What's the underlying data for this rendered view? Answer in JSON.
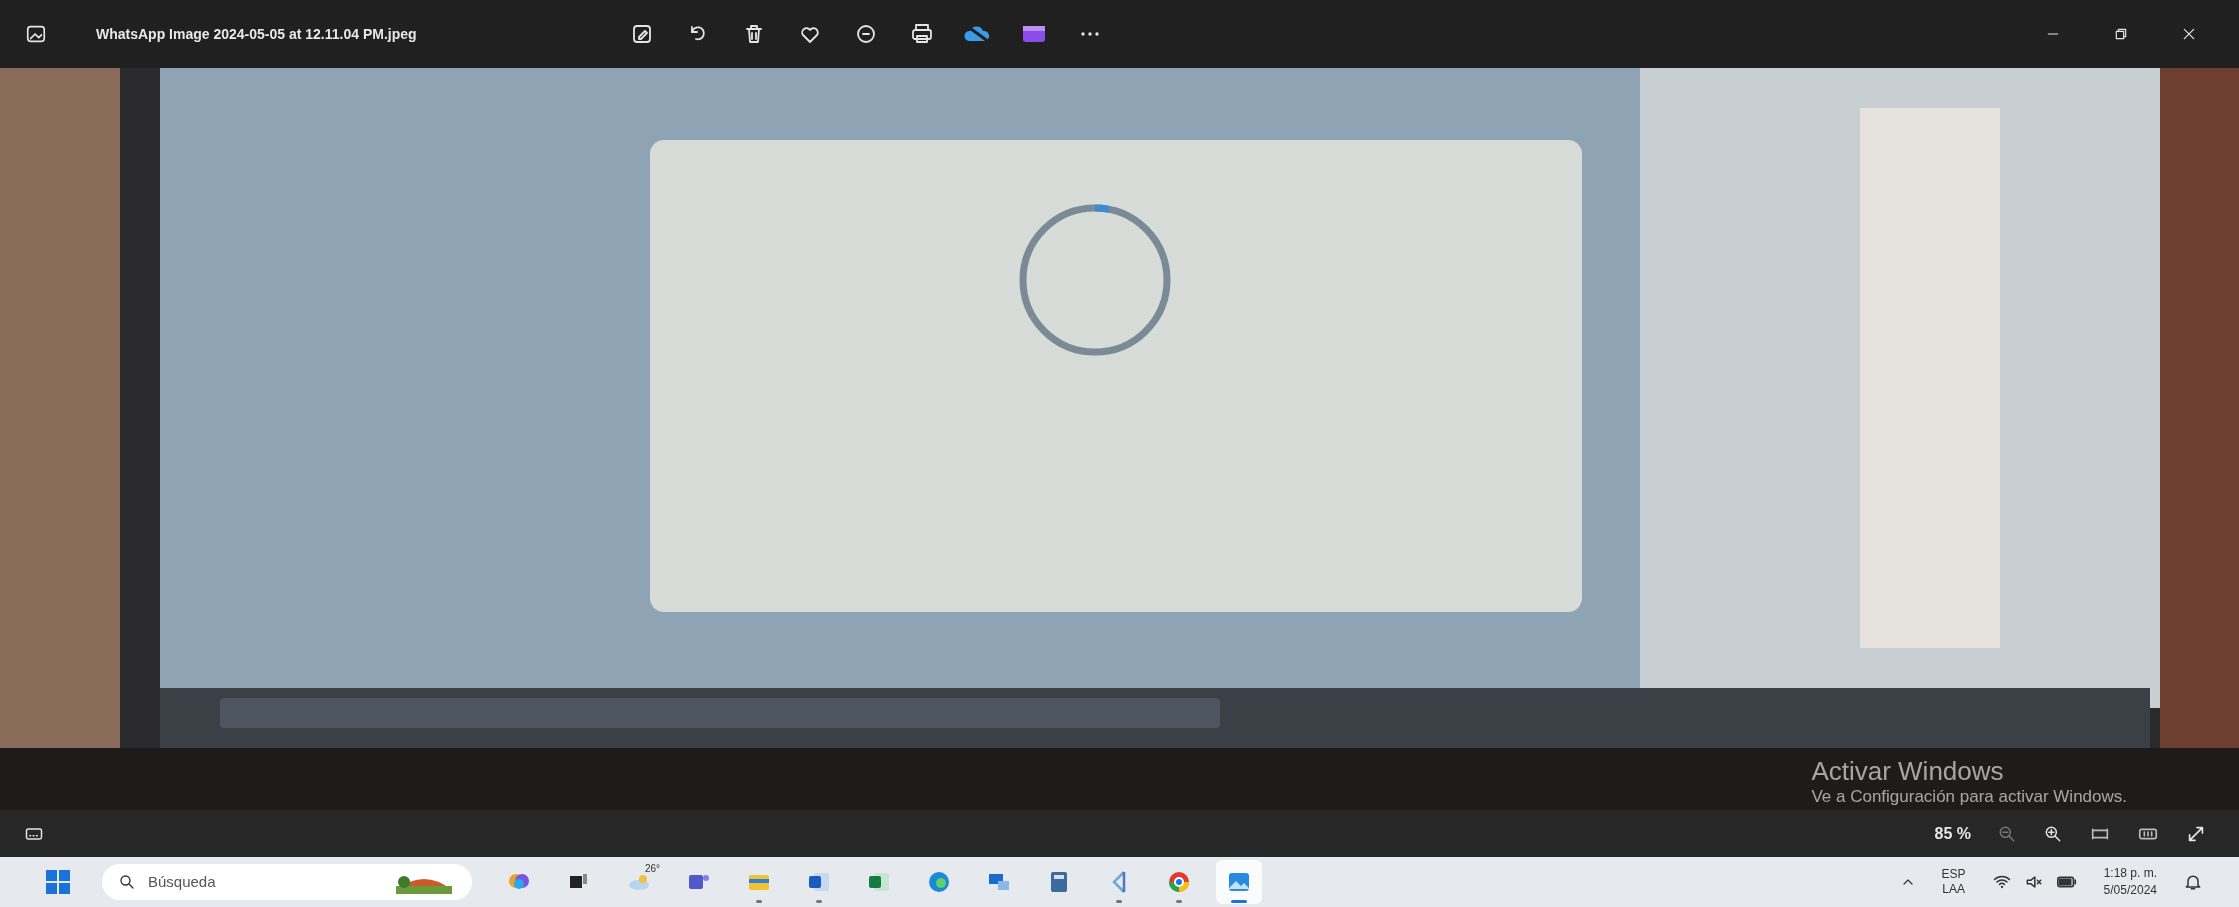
{
  "window": {
    "title": "WhatsApp Image 2024-05-05 at 12.11.04 PM.jpeg"
  },
  "activation_notice": {
    "title": "Activar Windows",
    "subtitle": "Ve a Configuración para activar Windows."
  },
  "zoom_bar": {
    "zoom": "85 %"
  },
  "taskbar": {
    "search": {
      "placeholder": "Búsqueda"
    },
    "weather": "26°",
    "apps": [
      {
        "kind": "copilot",
        "running": false,
        "selected": false
      },
      {
        "kind": "taskview",
        "running": false,
        "selected": false
      },
      {
        "kind": "weather",
        "running": false,
        "selected": false
      },
      {
        "kind": "teams",
        "running": false,
        "selected": false
      },
      {
        "kind": "explorer",
        "running": true,
        "selected": false
      },
      {
        "kind": "word",
        "running": true,
        "selected": false
      },
      {
        "kind": "excel",
        "running": false,
        "selected": false
      },
      {
        "kind": "edge",
        "running": false,
        "selected": false
      },
      {
        "kind": "remote",
        "running": false,
        "selected": false
      },
      {
        "kind": "calculator",
        "running": false,
        "selected": false
      },
      {
        "kind": "vscode",
        "running": true,
        "selected": false
      },
      {
        "kind": "chrome",
        "running": true,
        "selected": false
      },
      {
        "kind": "photos",
        "running": true,
        "selected": true
      }
    ],
    "language": [
      "ESP",
      "LAA"
    ],
    "time": "1:18 p. m.",
    "date": "5/05/2024"
  }
}
